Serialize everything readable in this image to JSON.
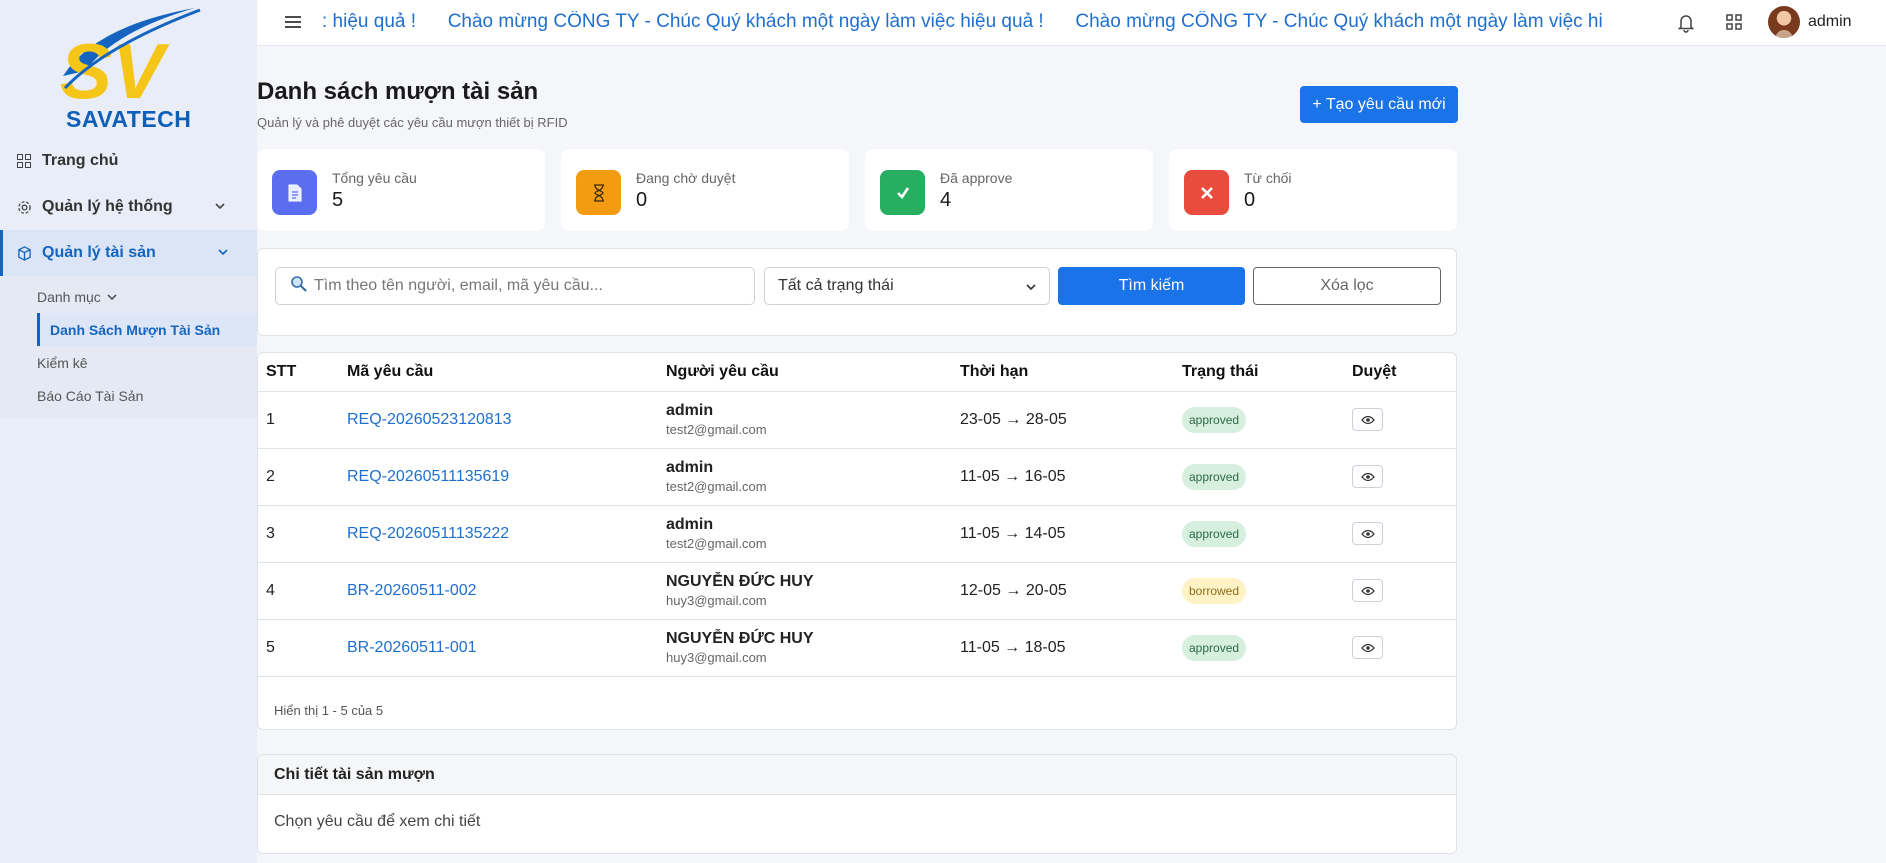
{
  "brand": {
    "name": "SAVATECH"
  },
  "sidebar": {
    "items": [
      {
        "label": "Trang chủ",
        "icon": "dashboard-icon"
      },
      {
        "label": "Quản lý hệ thống",
        "icon": "gear-icon"
      },
      {
        "label": "Quản lý tài sản",
        "icon": "box-icon"
      }
    ],
    "submenu": [
      {
        "label": "Danh mục"
      },
      {
        "label": "Danh Sách Mượn Tài Sản"
      },
      {
        "label": "Kiểm kê"
      },
      {
        "label": "Báo Cáo Tài Sản"
      }
    ]
  },
  "topbar": {
    "marquee": ": hiệu quả !      Chào mừng CÔNG TY - Chúc Quý khách một ngày làm việc hiệu quả !      Chào mừng CÔNG TY - Chúc Quý khách một ngày làm việc hi",
    "username": "admin"
  },
  "page": {
    "title": "Danh sách mượn tài sản",
    "subtitle": "Quản lý và phê duyệt các yêu cầu mượn thiết bị RFID",
    "create_button": "+ Tạo yêu cầu mới"
  },
  "stats": [
    {
      "label": "Tổng yêu cầu",
      "value": "5",
      "color": "#5b6ef0",
      "icon": "document-icon"
    },
    {
      "label": "Đang chờ duyệt",
      "value": "0",
      "color": "#f39c12",
      "icon": "hourglass-icon"
    },
    {
      "label": "Đã approve",
      "value": "4",
      "color": "#27ae60",
      "icon": "check-icon"
    },
    {
      "label": "Từ chối",
      "value": "0",
      "color": "#e74c3c",
      "icon": "x-icon"
    }
  ],
  "filter": {
    "search_placeholder": "Tìm theo tên người, email, mã yêu cầu...",
    "status_selected": "Tất cả trạng thái",
    "search_button": "Tìm kiếm",
    "clear_button": "Xóa lọc"
  },
  "table": {
    "headers": [
      "STT",
      "Mã yêu cầu",
      "Người yêu cầu",
      "Thời hạn",
      "Trạng thái",
      "Duyệt"
    ],
    "rows": [
      {
        "stt": "1",
        "code": "REQ-20260523120813",
        "name": "admin",
        "email": "test2@gmail.com",
        "period": "23-05 → 28-05",
        "status": "approved"
      },
      {
        "stt": "2",
        "code": "REQ-20260511135619",
        "name": "admin",
        "email": "test2@gmail.com",
        "period": "11-05 → 16-05",
        "status": "approved"
      },
      {
        "stt": "3",
        "code": "REQ-20260511135222",
        "name": "admin",
        "email": "test2@gmail.com",
        "period": "11-05 → 14-05",
        "status": "approved"
      },
      {
        "stt": "4",
        "code": "BR-20260511-002",
        "name": "NGUYỄN ĐỨC HUY",
        "email": "huy3@gmail.com",
        "period": "12-05 → 20-05",
        "status": "borrowed"
      },
      {
        "stt": "5",
        "code": "BR-20260511-001",
        "name": "NGUYỄN ĐỨC HUY",
        "email": "huy3@gmail.com",
        "period": "11-05 → 18-05",
        "status": "approved"
      }
    ],
    "footer": "Hiển thị 1 - 5 của 5"
  },
  "detail": {
    "title": "Chi tiết tài sản mượn",
    "placeholder": "Chọn yêu cầu để xem chi tiết"
  }
}
